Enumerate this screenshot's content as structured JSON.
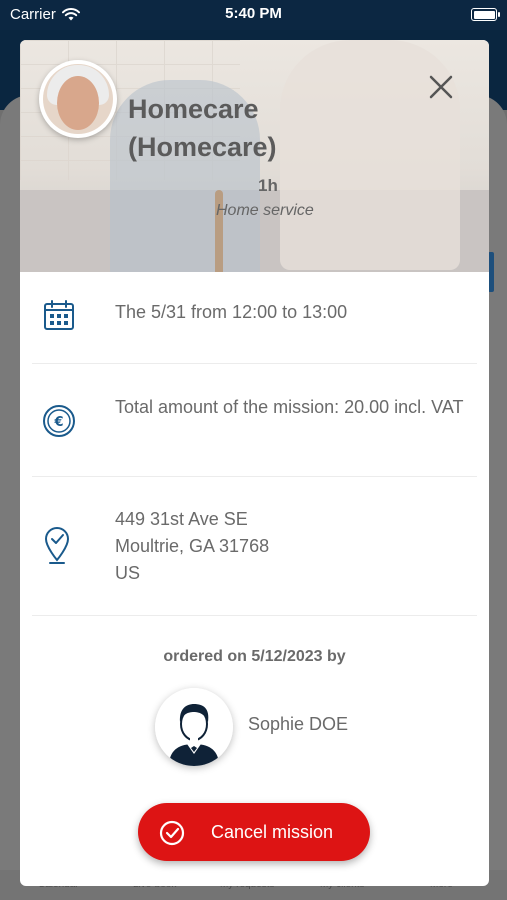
{
  "status_bar": {
    "carrier": "Carrier",
    "time": "5:40 PM"
  },
  "tabbar": {
    "items": [
      "Calendar",
      "Live-book",
      "My requests",
      "My clients",
      "More"
    ]
  },
  "mission": {
    "title": "Homecare\n(Homecare)",
    "duration": "1h",
    "service_type": "Home service",
    "schedule": "The 5/31 from 12:00 to 13:00",
    "amount": "Total amount of the mission: 20.00 incl. VAT",
    "address": "449 31st Ave SE\nMoultrie, GA 31768\nUS"
  },
  "order": {
    "ordered_text": "ordered on 5/12/2023 by",
    "client_name": "Sophie DOE"
  },
  "actions": {
    "cancel_label": "Cancel mission"
  },
  "icons": {
    "close": "close-icon",
    "calendar": "calendar-icon",
    "euro": "euro-icon",
    "location": "location-pin-icon",
    "check": "check-circle-icon",
    "wifi": "wifi-icon",
    "battery": "battery-icon"
  },
  "colors": {
    "primary": "#1a5a8c",
    "danger": "#dd1414",
    "header": "#0c2742",
    "text": "#6a6a6a"
  }
}
